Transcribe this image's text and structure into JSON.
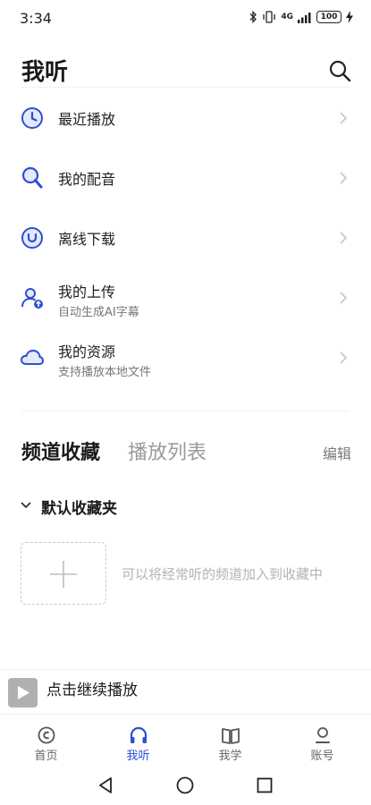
{
  "status_bar": {
    "time": "3:34",
    "network": "4G",
    "battery": "100"
  },
  "header": {
    "title": "我听",
    "search_icon": "search-icon"
  },
  "menu": {
    "items": [
      {
        "label": "最近播放",
        "subtitle": "",
        "icon": "clock-icon"
      },
      {
        "label": "我的配音",
        "subtitle": "",
        "icon": "magnifier-mic-icon"
      },
      {
        "label": "离线下载",
        "subtitle": "",
        "icon": "download-icon"
      },
      {
        "label": "我的上传",
        "subtitle": "自动生成AI字幕",
        "icon": "user-upload-icon"
      },
      {
        "label": "我的资源",
        "subtitle": "支持播放本地文件",
        "icon": "cloud-icon"
      }
    ]
  },
  "favorites": {
    "tab_active": "频道收藏",
    "tab_inactive": "播放列表",
    "edit_label": "编辑",
    "folder_label": "默认收藏夹",
    "add_hint": "可以将经常听的频道加入到收藏中"
  },
  "player": {
    "label": "点击继续播放"
  },
  "bottom_nav": {
    "items": [
      {
        "label": "首页",
        "icon": "home-icon"
      },
      {
        "label": "我听",
        "icon": "headphones-icon",
        "active": true
      },
      {
        "label": "我学",
        "icon": "book-icon"
      },
      {
        "label": "账号",
        "icon": "account-icon"
      }
    ]
  },
  "colors": {
    "accent": "#2e4fd1",
    "text_primary": "#1a1a1a",
    "text_secondary": "#777777",
    "hint": "#b3b3b3"
  }
}
